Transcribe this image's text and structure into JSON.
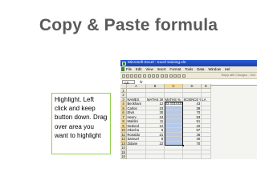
{
  "slide": {
    "title": "Copy & Paste formula",
    "note": "Highlight. Left click and keep button down. Drag over area you want to highlight"
  },
  "excel": {
    "window_title": "Microsoft Excel - excel training.xls",
    "menu": [
      "File",
      "Edit",
      "View",
      "Insert",
      "Format",
      "Tools",
      "Data",
      "Window",
      "Hel"
    ],
    "reply_hint": "Reply with Changes...  End",
    "name_box": "C5",
    "fx": "fx",
    "column_headers": [
      "A",
      "B",
      "C",
      "D",
      "E"
    ],
    "rows": [
      {
        "num": "1",
        "a": "",
        "b": "",
        "c": "",
        "d": "",
        "e": ""
      },
      {
        "num": "2",
        "a": "",
        "b": "",
        "c": "",
        "d": "",
        "e": ""
      },
      {
        "num": "3",
        "a": "NAMES",
        "b": "MATHS 30",
        "c": "MATHS %",
        "d": "SCIENCE %",
        "e": "LA"
      },
      {
        "num": "4",
        "a": "Beckham",
        "b": "12",
        "c": "33.33333333",
        "d": "43",
        "e": ""
      },
      {
        "num": "5",
        "a": "Carlos",
        "b": "23",
        "c": "",
        "d": "39",
        "e": ""
      },
      {
        "num": "6",
        "a": "Elvis",
        "b": "30",
        "c": "",
        "d": "70",
        "e": ""
      },
      {
        "num": "7",
        "a": "Henry",
        "b": "24",
        "c": "",
        "d": "53",
        "e": ""
      },
      {
        "num": "8",
        "a": "Maldini",
        "b": "11",
        "c": "",
        "d": "51",
        "e": ""
      },
      {
        "num": "9",
        "a": "Nedved",
        "b": "12",
        "c": "",
        "d": "42",
        "e": ""
      },
      {
        "num": "10",
        "a": "Okocha",
        "b": "6",
        "c": "",
        "d": "67",
        "e": ""
      },
      {
        "num": "11",
        "a": "Ronaldo",
        "b": "21",
        "c": "",
        "d": "46",
        "e": ""
      },
      {
        "num": "12",
        "a": "Samuel",
        "b": "8",
        "c": "",
        "d": "40",
        "e": ""
      },
      {
        "num": "13",
        "a": "Zidane",
        "b": "22",
        "c": "",
        "d": "70",
        "e": ""
      },
      {
        "num": "14",
        "a": "",
        "b": "",
        "c": "",
        "d": "",
        "e": ""
      },
      {
        "num": "15",
        "a": "",
        "b": "",
        "c": "",
        "d": "",
        "e": ""
      },
      {
        "num": "16",
        "a": "",
        "b": "",
        "c": "",
        "d": "",
        "e": ""
      },
      {
        "num": "17",
        "a": "",
        "b": "",
        "c": "",
        "d": "",
        "e": ""
      }
    ],
    "selection": {
      "column": "C",
      "from_row": "4",
      "to_row": "13"
    },
    "colors": {
      "title_bar": "#1a3ea8",
      "selection_fill": "#b7c9e6",
      "header_highlight": "#f3d99a",
      "note_border": "#92d050"
    }
  }
}
